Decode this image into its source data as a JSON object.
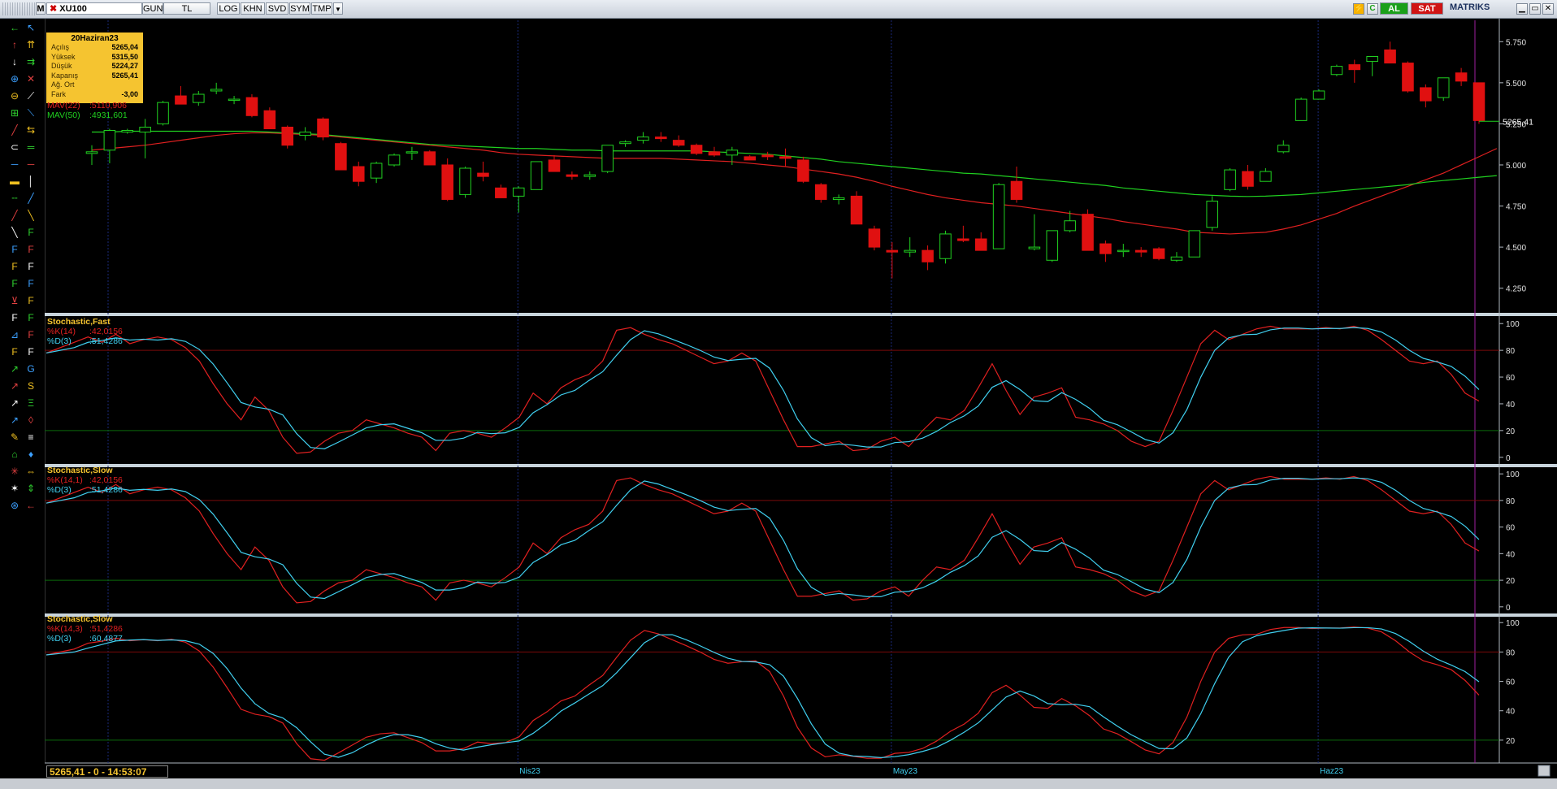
{
  "toolbar": {
    "symbol": "XU100",
    "buttons": [
      "GUN",
      "TL",
      "LOG",
      "KHN",
      "SVD",
      "SYM",
      "TMP"
    ],
    "al_label": "AL",
    "sat_label": "SAT",
    "brand": "MATRIKS",
    "colors": {
      "al": "#1aa01a",
      "sat": "#d01414"
    }
  },
  "info_box": {
    "date": "20Haziran23",
    "rows": [
      {
        "label": "Açılış",
        "value": "5265,04"
      },
      {
        "label": "Yüksek",
        "value": "5315,50"
      },
      {
        "label": "Düşük",
        "value": "5224,27"
      },
      {
        "label": "Kapanış",
        "value": "5265,41"
      },
      {
        "label": "Ağ. Ort",
        "value": ""
      },
      {
        "label": "Fark",
        "value": "-3,00"
      }
    ]
  },
  "price_legend": [
    {
      "name": "MAV(22)",
      "value": ":5110,906",
      "color": "#e02020"
    },
    {
      "name": "MAV(50)",
      "value": ":4931,601",
      "color": "#20d020"
    }
  ],
  "panels": [
    {
      "title": "Stochastic,Fast",
      "legend": [
        {
          "name": "%K(14)",
          "value": ":42,0156",
          "color": "#e02020"
        },
        {
          "name": "%D(3)",
          "value": ":51,4286",
          "color": "#40d0f0"
        }
      ]
    },
    {
      "title": "Stochastic,Slow",
      "legend": [
        {
          "name": "%K(14,1)",
          "value": ":42,0156",
          "color": "#e02020"
        },
        {
          "name": "%D(3)",
          "value": ":51,4286",
          "color": "#40d0f0"
        }
      ]
    },
    {
      "title": "Stochastic,Slow",
      "legend": [
        {
          "name": "%K(14,3)",
          "value": ":51,4286",
          "color": "#e02020"
        },
        {
          "name": "%D(3)",
          "value": ":60,4877",
          "color": "#40d0f0"
        }
      ]
    }
  ],
  "last_price_label": "5265,41",
  "status_text": "5265,41 - 0 - 14:53:07",
  "chart_data": {
    "type": "candlestick",
    "price_axis": {
      "ticks": [
        4250,
        4500,
        4750,
        5000,
        5250,
        5500,
        5750
      ],
      "tick_labels": [
        "4.250",
        "4.500",
        "4.750",
        "5.000",
        "5.250",
        "5.500",
        "5.750"
      ],
      "range": [
        4100,
        5880
      ]
    },
    "osc_axis": {
      "ticks": [
        0,
        20,
        40,
        60,
        80,
        100
      ],
      "range": [
        -5,
        105
      ]
    },
    "osc3_axis": {
      "ticks": [
        20,
        40,
        60,
        80,
        100
      ],
      "range": [
        5,
        104
      ]
    },
    "month_labels": [
      {
        "label": "Nis23",
        "index": 24
      },
      {
        "label": "May23",
        "index": 45
      },
      {
        "label": "Haz23",
        "index": 69
      }
    ],
    "candles": [
      [
        5070,
        5120,
        5000,
        5080
      ],
      [
        5090,
        5220,
        5010,
        5210
      ],
      [
        5200,
        5220,
        5190,
        5210
      ],
      [
        5200,
        5280,
        5040,
        5230
      ],
      [
        5250,
        5390,
        5240,
        5380
      ],
      [
        5420,
        5480,
        5380,
        5370
      ],
      [
        5380,
        5450,
        5360,
        5430
      ],
      [
        5450,
        5500,
        5430,
        5460
      ],
      [
        5400,
        5420,
        5370,
        5400
      ],
      [
        5410,
        5430,
        5290,
        5300
      ],
      [
        5330,
        5350,
        5220,
        5220
      ],
      [
        5230,
        5240,
        5100,
        5120
      ],
      [
        5180,
        5230,
        5150,
        5200
      ],
      [
        5280,
        5290,
        5150,
        5170
      ],
      [
        5130,
        5140,
        4970,
        4970
      ],
      [
        4990,
        5020,
        4870,
        4900
      ],
      [
        4920,
        5020,
        4890,
        5010
      ],
      [
        5000,
        5070,
        4990,
        5060
      ],
      [
        5080,
        5110,
        5030,
        5080
      ],
      [
        5080,
        5090,
        5000,
        5000
      ],
      [
        5000,
        5040,
        4780,
        4790
      ],
      [
        4820,
        4990,
        4800,
        4980
      ],
      [
        4950,
        5020,
        4900,
        4930
      ],
      [
        4860,
        4880,
        4800,
        4800
      ],
      [
        4810,
        4870,
        4710,
        4860
      ],
      [
        4850,
        5000,
        4850,
        5020
      ],
      [
        5030,
        5060,
        4960,
        4960
      ],
      [
        4940,
        4960,
        4910,
        4930
      ],
      [
        4930,
        4960,
        4910,
        4940
      ],
      [
        4960,
        5100,
        4950,
        5120
      ],
      [
        5130,
        5150,
        5110,
        5140
      ],
      [
        5150,
        5200,
        5130,
        5170
      ],
      [
        5170,
        5200,
        5140,
        5160
      ],
      [
        5150,
        5180,
        5110,
        5120
      ],
      [
        5120,
        5130,
        5060,
        5070
      ],
      [
        5080,
        5110,
        5050,
        5060
      ],
      [
        5060,
        5110,
        5000,
        5090
      ],
      [
        5050,
        5060,
        5030,
        5030
      ],
      [
        5060,
        5080,
        5030,
        5050
      ],
      [
        5050,
        5100,
        4990,
        5040
      ],
      [
        5030,
        5050,
        4890,
        4900
      ],
      [
        4880,
        4890,
        4770,
        4790
      ],
      [
        4790,
        4820,
        4760,
        4800
      ],
      [
        4810,
        4840,
        4640,
        4640
      ],
      [
        4610,
        4630,
        4480,
        4500
      ],
      [
        4480,
        4530,
        4310,
        4470
      ],
      [
        4470,
        4560,
        4440,
        4480
      ],
      [
        4480,
        4510,
        4360,
        4410
      ],
      [
        4430,
        4600,
        4400,
        4580
      ],
      [
        4550,
        4630,
        4530,
        4540
      ],
      [
        4550,
        4590,
        4480,
        4480
      ],
      [
        4490,
        4890,
        4490,
        4880
      ],
      [
        4900,
        4990,
        4770,
        4790
      ],
      [
        4490,
        4700,
        4480,
        4500
      ],
      [
        4420,
        4600,
        4410,
        4600
      ],
      [
        4600,
        4720,
        4590,
        4660
      ],
      [
        4700,
        4730,
        4500,
        4480
      ],
      [
        4520,
        4540,
        4410,
        4460
      ],
      [
        4480,
        4520,
        4440,
        4480
      ],
      [
        4480,
        4500,
        4440,
        4470
      ],
      [
        4490,
        4500,
        4420,
        4430
      ],
      [
        4420,
        4470,
        4410,
        4440
      ],
      [
        4440,
        4600,
        4440,
        4600
      ],
      [
        4620,
        4810,
        4600,
        4780
      ],
      [
        4850,
        4980,
        4840,
        4970
      ],
      [
        4960,
        5000,
        4850,
        4870
      ],
      [
        4900,
        4980,
        4900,
        4960
      ],
      [
        5080,
        5150,
        5070,
        5120
      ],
      [
        5270,
        5410,
        5270,
        5400
      ],
      [
        5400,
        5460,
        5400,
        5450
      ],
      [
        5550,
        5610,
        5540,
        5600
      ],
      [
        5610,
        5640,
        5500,
        5580
      ],
      [
        5630,
        5660,
        5540,
        5660
      ],
      [
        5700,
        5750,
        5630,
        5620
      ],
      [
        5620,
        5630,
        5440,
        5450
      ],
      [
        5470,
        5490,
        5350,
        5390
      ],
      [
        5410,
        5530,
        5390,
        5530
      ],
      [
        5560,
        5590,
        5480,
        5510
      ],
      [
        5500,
        5500,
        5250,
        5270
      ]
    ],
    "mav22": [
      5090,
      5100,
      5110,
      5120,
      5135,
      5150,
      5165,
      5180,
      5190,
      5195,
      5195,
      5190,
      5185,
      5180,
      5170,
      5160,
      5150,
      5140,
      5130,
      5120,
      5110,
      5100,
      5090,
      5075,
      5065,
      5060,
      5055,
      5050,
      5045,
      5040,
      5040,
      5040,
      5040,
      5035,
      5030,
      5025,
      5020,
      5010,
      5000,
      4990,
      4975,
      4960,
      4945,
      4925,
      4900,
      4870,
      4845,
      4820,
      4800,
      4785,
      4770,
      4760,
      4750,
      4735,
      4720,
      4705,
      4690,
      4675,
      4655,
      4640,
      4625,
      4610,
      4590,
      4585,
      4580,
      4585,
      4590,
      4610,
      4635,
      4670,
      4705,
      4750,
      4790,
      4830,
      4870,
      4910,
      4950,
      5000,
      5050,
      5100
    ],
    "mav50": [
      5200,
      5200,
      5205,
      5205,
      5205,
      5205,
      5205,
      5205,
      5205,
      5205,
      5200,
      5195,
      5190,
      5185,
      5175,
      5165,
      5155,
      5145,
      5135,
      5125,
      5120,
      5115,
      5110,
      5105,
      5100,
      5100,
      5095,
      5090,
      5090,
      5085,
      5085,
      5085,
      5085,
      5085,
      5085,
      5080,
      5075,
      5070,
      5065,
      5055,
      5045,
      5035,
      5020,
      5010,
      5000,
      4990,
      4980,
      4970,
      4960,
      4950,
      4945,
      4935,
      4925,
      4915,
      4905,
      4895,
      4885,
      4875,
      4860,
      4850,
      4840,
      4830,
      4820,
      4815,
      4810,
      4808,
      4810,
      4815,
      4820,
      4830,
      4840,
      4850,
      4860,
      4870,
      4880,
      4895,
      4905,
      4915,
      4925,
      4935
    ],
    "stoch_fast_k": [
      78,
      82,
      86,
      90,
      86,
      92,
      85,
      88,
      90,
      88,
      82,
      72,
      55,
      40,
      28,
      45,
      35,
      15,
      3,
      4,
      12,
      18,
      20,
      28,
      25,
      22,
      18,
      15,
      5,
      18,
      20,
      18,
      15,
      22,
      30,
      48,
      40,
      52,
      58,
      62,
      72,
      95,
      97,
      92,
      88,
      85,
      80,
      75,
      70,
      72,
      78,
      72,
      50,
      28,
      8,
      8,
      10,
      12,
      5,
      6,
      12,
      15,
      8,
      20,
      30,
      28,
      35,
      52,
      70,
      50,
      32,
      45,
      48,
      52,
      30,
      28,
      25,
      20,
      12,
      8,
      12,
      35,
      60,
      85,
      95,
      88,
      92,
      96,
      98,
      96,
      96,
      96,
      97,
      96,
      98,
      95,
      88,
      80,
      72,
      70,
      72,
      62,
      48,
      42
    ]
  }
}
